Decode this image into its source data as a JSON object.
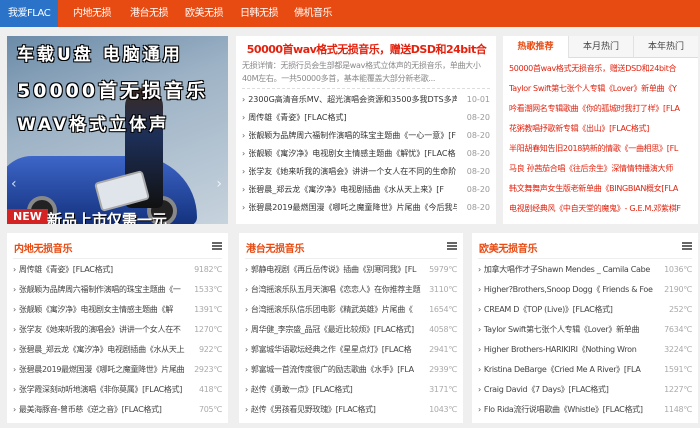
{
  "nav": {
    "items": [
      {
        "label": "我爱FLAC",
        "active": true
      },
      {
        "label": "内地无损",
        "active": false
      },
      {
        "label": "港台无损",
        "active": false
      },
      {
        "label": "欧美无损",
        "active": false
      },
      {
        "label": "日韩无损",
        "active": false
      },
      {
        "label": "佛机音乐",
        "active": false
      }
    ]
  },
  "banner": {
    "line1": "车载U盘 电脑通用",
    "line2": "50000首无损音乐",
    "line3": "WAV格式立体声",
    "new_badge": "NEW",
    "bottom_text": "新品上市仅需一元"
  },
  "news": {
    "headline": "50000首wav格式无损音乐，赠送DSD和24bit合",
    "description": "无损详情：无损行员会生部都是wav格式立体声的无损音乐，单曲大小40M左右。一共50000多首，基本能覆盖大部分新老歌...",
    "items": [
      {
        "title": "2300G高清音乐MV、超光演唱会资源和3500多我DTS多声",
        "date": "10-01"
      },
      {
        "title": "周传雄《青姿》[FLAC格式]",
        "date": "08-20"
      },
      {
        "title": "张靓颖为品牌周六福制作演唱的珠宝主题曲《一心一意》[F",
        "date": "08-20"
      },
      {
        "title": "张靓颖《寓汐净》电视剧女主情感主题曲《解忧》[FLAC格",
        "date": "08-20"
      },
      {
        "title": "张学友《她来听我的演唱会》讲讲一个女人在不同的生命阶",
        "date": "08-20"
      },
      {
        "title": "张碧晨_郑云龙《寓汐净》电视剧插曲《水从天上来》[F",
        "date": "08-20"
      },
      {
        "title": "张碧晨2019最燃国漫《哪吒之魔童降世》片尾曲《今后我与",
        "date": "08-20"
      }
    ]
  },
  "rank": {
    "tabs": [
      "热歌推荐",
      "本月热门",
      "本年热门"
    ],
    "items": [
      "50000首wav格式无损音乐，赠送DSD和24bit合",
      "Taylor Swift第七张个人专辑《Lover》新单曲《Y",
      "吟看潮网名专辑歌曲《你的孤城时我打了样》[FLA",
      "花粥教唱抒歌新专辑《出山》[FLAC格式]",
      "半阳胡春知告旧2018鸫新的情歌《一曲相思》[FL",
      "马良 孙茜茄合唱《往后余生》深情情特播演大师",
      "韩文舞舞声女生版老新单曲《BINGBIAN概女[FLA",
      "电视剧经典风《中自天堂的魔鬼》- G.E.M.邓紫棋F"
    ]
  },
  "boxes": [
    {
      "title": "内地无损音乐",
      "rows": [
        {
          "title": "周传雄《青姿》[FLAC格式]",
          "count": "9182℃"
        },
        {
          "title": "张靓颖为品牌周六福制作演唱的珠宝主题曲《一",
          "count": "1533℃"
        },
        {
          "title": "张靓颖《寓汐净》电视剧女主情感主题曲《解",
          "count": "1391℃"
        },
        {
          "title": "张学友《她来听我的演唱会》讲讲一个女人在不",
          "count": "1270℃"
        },
        {
          "title": "张碧晨_郑云龙《寓汐净》电视剧插曲《水从天上",
          "count": "922℃"
        },
        {
          "title": "张碧晨2019最燃国漫《哪吒之魔童降世》片尾曲",
          "count": "2923℃"
        },
        {
          "title": "张学霞深刻动听地演唱《非你莫属》[FLAC格式]",
          "count": "418℃"
        },
        {
          "title": "最美海豚音-曾币慈《逆之音》[FLAC格式]",
          "count": "705℃"
        }
      ]
    },
    {
      "title": "港台无损音乐",
      "rows": [
        {
          "title": "郭静电视剧《再丘岳传说》插曲《别寒同我》[FL",
          "count": "5979℃"
        },
        {
          "title": "台湾摇滚乐队五月天演唱《恋恋人》在你推荐主题",
          "count": "3110℃"
        },
        {
          "title": "台湾摇滚乐队信乐团电影《精武英雄》片尾曲《",
          "count": "1654℃"
        },
        {
          "title": "周华健_李宗盛_品冠《最近比较烦》[FLAC格式]",
          "count": "4058℃"
        },
        {
          "title": "郭富城华语歌坛经典之作《星星点灯》[FLAC格",
          "count": "2941℃"
        },
        {
          "title": "郭富城一首流传度很广的励志歌曲《水手》[FLA",
          "count": "2939℃"
        },
        {
          "title": "赵传《勇敢一点》[FLAC格式]",
          "count": "3171℃"
        },
        {
          "title": "赵传《男孩看见野玫瑰》[FLAC格式]",
          "count": "1043℃"
        }
      ]
    },
    {
      "title": "欧美无损音乐",
      "rows": [
        {
          "title": "加拿大唱作才子Shawn Mendes _ Camila Cabe",
          "count": "1036℃"
        },
        {
          "title": "Higher?Brothers,Snoop Dogg《 Friends & Foe",
          "count": "2190℃"
        },
        {
          "title": "CREAM D《TOP (Live)》[FLAC格式]",
          "count": "252℃"
        },
        {
          "title": "Taylor Swift第七张个人专辑《Lover》新单曲",
          "count": "7634℃"
        },
        {
          "title": "Higher Brothers-HARIKIRI《Nothing Wron",
          "count": "3224℃"
        },
        {
          "title": "Kristina DeBarge《Cried Me A River》[FLA",
          "count": "1591℃"
        },
        {
          "title": "Craig David《7 Days》[FLAC格式]",
          "count": "1227℃"
        },
        {
          "title": "Flo Rida流行说唱歌曲《Whistle》[FLAC格式]",
          "count": "1148℃"
        }
      ]
    }
  ]
}
